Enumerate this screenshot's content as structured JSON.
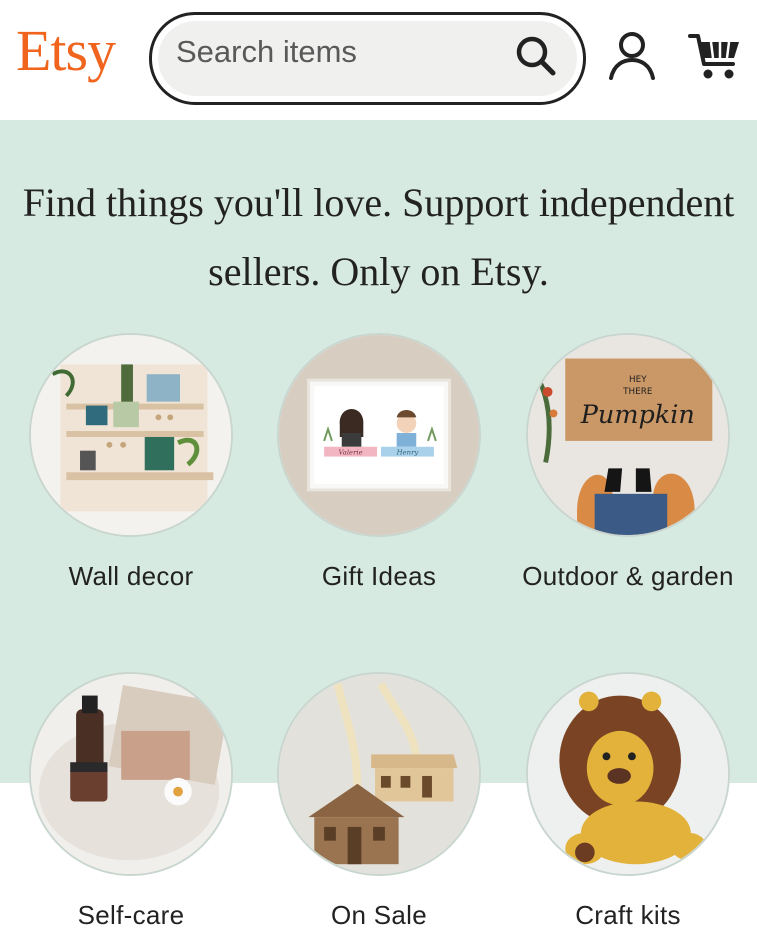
{
  "header": {
    "logo": "Etsy",
    "search_placeholder": "Search items",
    "search_icon": "search-icon",
    "account_icon": "account-icon",
    "cart_icon": "cart-icon",
    "brand_color": "#f1641e"
  },
  "hero": {
    "title": "Find things you'll love. Support independent sellers. Only on Etsy.",
    "background": "#d7eae1"
  },
  "categories": [
    {
      "label": "Wall decor"
    },
    {
      "label": "Gift Ideas",
      "image_text": [
        "Valerie",
        "Henry"
      ]
    },
    {
      "label": "Outdoor & garden",
      "image_text": [
        "HEY",
        "THERE",
        "Pumpkin"
      ]
    },
    {
      "label": "Self-care"
    },
    {
      "label": "On Sale"
    },
    {
      "label": "Craft kits"
    }
  ]
}
